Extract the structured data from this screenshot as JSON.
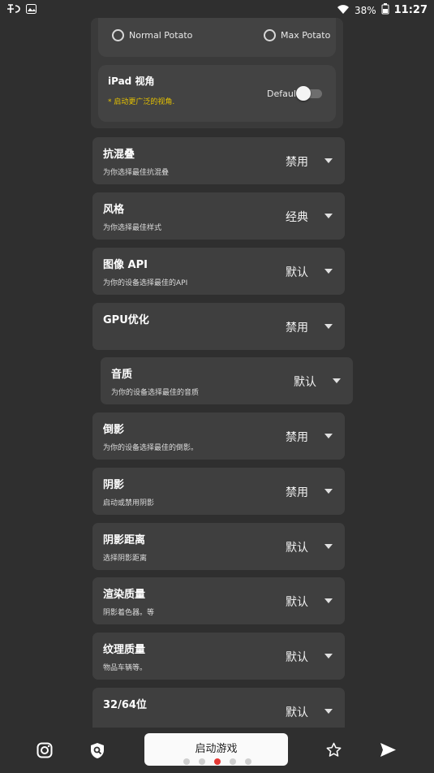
{
  "status_bar": {
    "time": "11:27",
    "battery": "38%"
  },
  "potato": {
    "normal_label": "Normal Potato",
    "max_label": "Max Potato"
  },
  "ipad": {
    "title": "iPad 视角",
    "note": "* 启动更广泛的视角.",
    "toggle_label": "Default",
    "toggle_on": false
  },
  "settings": [
    {
      "title": "抗混叠",
      "subtitle": "为你选择最佳抗混叠",
      "value": "禁用"
    },
    {
      "title": "风格",
      "subtitle": "为你选择最佳样式",
      "value": "经典"
    },
    {
      "title": "图像 API",
      "subtitle": "为你的设备选择最佳的API",
      "value": "默认"
    },
    {
      "title": "GPU优化",
      "subtitle": "",
      "value": "禁用"
    },
    {
      "title": "音质",
      "subtitle": "为你的设备选择最佳的音质",
      "value": "默认"
    },
    {
      "title": "倒影",
      "subtitle": "为你的设备选择最佳的倒影。",
      "value": "禁用"
    },
    {
      "title": "阴影",
      "subtitle": "启动或禁用阴影",
      "value": "禁用"
    },
    {
      "title": "阴影距离",
      "subtitle": "选择阴影距离",
      "value": "默认"
    },
    {
      "title": "渲染质量",
      "subtitle": "阴影着色器。等",
      "value": "默认"
    },
    {
      "title": "纹理质量",
      "subtitle": "物品车辆等。",
      "value": "默认"
    },
    {
      "title": "32/64位",
      "subtitle": "",
      "value": "默认"
    }
  ],
  "bottom": {
    "launch_label": "启动游戏",
    "page_count": 5,
    "active_page": 2
  },
  "colors": {
    "background": "#2f2f2f",
    "card": "#3f3f3f",
    "note": "#e6c200",
    "active_dot": "#e53935"
  }
}
